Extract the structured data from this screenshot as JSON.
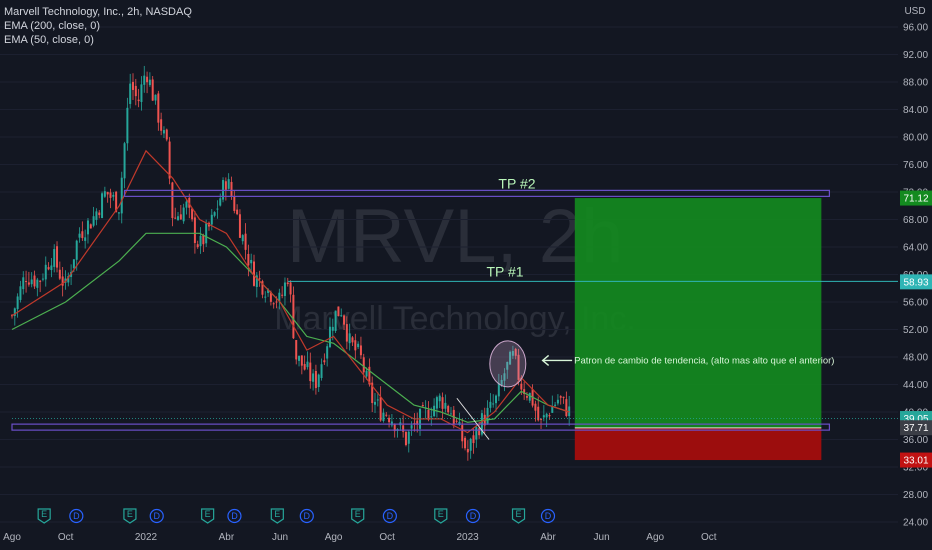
{
  "header": {
    "symbol_line": "Marvell Technology, Inc., 2h, NASDAQ",
    "indicator_1": "EMA (200, close, 0)",
    "indicator_2": "EMA (50, close, 0)"
  },
  "watermark": {
    "ticker": "MRVL, 2h",
    "company": "Marvell Technology, Inc."
  },
  "colors": {
    "background": "#131722",
    "candle_up": "#26a69a",
    "candle_down": "#ef5350",
    "ema200": "#4caf50",
    "ema50": "#c0392b",
    "profit_zone": "#138a1f",
    "loss_zone": "#a30d0d",
    "level_line": "#6b4fc8",
    "tp1_line": "#2fb5b5"
  },
  "chart_data": {
    "type": "candlestick",
    "currency": "USD",
    "y_range": [
      24,
      96
    ],
    "y_ticks": [
      "96.00",
      "92.00",
      "88.00",
      "84.00",
      "80.00",
      "76.00",
      "72.00",
      "68.00",
      "64.00",
      "60.00",
      "56.00",
      "52.00",
      "48.00",
      "44.00",
      "40.00",
      "36.00",
      "32.00",
      "28.00",
      "24.00"
    ],
    "x_ticks": [
      {
        "label": "Ago",
        "t": 0
      },
      {
        "label": "Oct",
        "t": 2
      },
      {
        "label": "2022",
        "t": 5
      },
      {
        "label": "Abr",
        "t": 8
      },
      {
        "label": "Jun",
        "t": 10
      },
      {
        "label": "Ago",
        "t": 12
      },
      {
        "label": "Oct",
        "t": 14
      },
      {
        "label": "2023",
        "t": 17
      },
      {
        "label": "Abr",
        "t": 20
      },
      {
        "label": "Jun",
        "t": 22
      },
      {
        "label": "Ago",
        "t": 24
      },
      {
        "label": "Oct",
        "t": 26
      }
    ],
    "price_path": [
      [
        0,
        54
      ],
      [
        0.5,
        60
      ],
      [
        1,
        59
      ],
      [
        1.5,
        63
      ],
      [
        2,
        58
      ],
      [
        2.5,
        66
      ],
      [
        3,
        68
      ],
      [
        3.5,
        72
      ],
      [
        4,
        70
      ],
      [
        4.4,
        88
      ],
      [
        4.7,
        85
      ],
      [
        5,
        90
      ],
      [
        5.4,
        84
      ],
      [
        5.8,
        78
      ],
      [
        6,
        68
      ],
      [
        6.5,
        70
      ],
      [
        6.8,
        66
      ],
      [
        7,
        64
      ],
      [
        7.5,
        68
      ],
      [
        8,
        74
      ],
      [
        8.3,
        70
      ],
      [
        8.7,
        64
      ],
      [
        9,
        60
      ],
      [
        9.5,
        58
      ],
      [
        10,
        56
      ],
      [
        10.3,
        60
      ],
      [
        10.6,
        48
      ],
      [
        11,
        46
      ],
      [
        11.3,
        44
      ],
      [
        11.6,
        48
      ],
      [
        12,
        54
      ],
      [
        12.3,
        55
      ],
      [
        12.6,
        50
      ],
      [
        13,
        48
      ],
      [
        13.4,
        42
      ],
      [
        13.8,
        40
      ],
      [
        14,
        40
      ],
      [
        14.4,
        38
      ],
      [
        14.7,
        36
      ],
      [
        15,
        38
      ],
      [
        15.5,
        40
      ],
      [
        16,
        42
      ],
      [
        16.4,
        40
      ],
      [
        16.8,
        36
      ],
      [
        17,
        34
      ],
      [
        17.4,
        38
      ],
      [
        17.8,
        40
      ],
      [
        18.1,
        42
      ],
      [
        18.4,
        46
      ],
      [
        18.7,
        48
      ],
      [
        19,
        44
      ],
      [
        19.4,
        42
      ],
      [
        19.7,
        38
      ],
      [
        20,
        40
      ],
      [
        20.4,
        42
      ],
      [
        20.8,
        40
      ]
    ],
    "ema200": [
      [
        0,
        52
      ],
      [
        2,
        56
      ],
      [
        4,
        62
      ],
      [
        5,
        66
      ],
      [
        6,
        66
      ],
      [
        7,
        66
      ],
      [
        8,
        64
      ],
      [
        9,
        60
      ],
      [
        10,
        56
      ],
      [
        11,
        51
      ],
      [
        12,
        50
      ],
      [
        13,
        47
      ],
      [
        14,
        44
      ],
      [
        15,
        41
      ],
      [
        16,
        40
      ],
      [
        17,
        38.5
      ],
      [
        18,
        39
      ],
      [
        19,
        43
      ],
      [
        20,
        41
      ],
      [
        20.8,
        40
      ]
    ],
    "ema50": [
      [
        0,
        54
      ],
      [
        2,
        59
      ],
      [
        4,
        70
      ],
      [
        5,
        78
      ],
      [
        6,
        74
      ],
      [
        7,
        68
      ],
      [
        8,
        66
      ],
      [
        9,
        60
      ],
      [
        10,
        56
      ],
      [
        11,
        49
      ],
      [
        12,
        51
      ],
      [
        13,
        46
      ],
      [
        14,
        41
      ],
      [
        15,
        39
      ],
      [
        16,
        39
      ],
      [
        17,
        37
      ],
      [
        18,
        40
      ],
      [
        19,
        45
      ],
      [
        20,
        41
      ],
      [
        20.8,
        40
      ]
    ],
    "levels": [
      {
        "name": "TP #2",
        "label": "TP #2",
        "price": 71.8,
        "t_start": 4.2,
        "t_end": 30.5
      },
      {
        "name": "TP #1",
        "label": "TP #1",
        "price": 59.0,
        "t_start": 10.3,
        "t_end": 35
      },
      {
        "name": "support",
        "price": 37.8,
        "t_start": 0,
        "t_end": 30.5
      },
      {
        "name": "last",
        "price": 39.05,
        "t_start": 0,
        "t_end": 35
      }
    ],
    "position": {
      "t_start": 21.0,
      "t_end": 30.2,
      "entry": 37.7,
      "target": 71.12,
      "stop": 33.01
    },
    "annotation": {
      "text": "Patron de cambio de tendencia, (alto mas alto que el anterior)",
      "t": 18.5,
      "price": 47.0
    },
    "price_labels": [
      {
        "value": "71.12",
        "price": 71.12,
        "color": "#138a1f"
      },
      {
        "value": "58.93",
        "price": 58.93,
        "color": "#2fb5b5"
      },
      {
        "value": "39.05",
        "price": 39.05,
        "color": "#26a69a"
      },
      {
        "value": "37.71",
        "price": 37.71,
        "color": "#3b3e46"
      },
      {
        "value": "33.01",
        "price": 33.01,
        "color": "#c21212"
      }
    ],
    "events": [
      {
        "type": "E",
        "t": 1.2
      },
      {
        "type": "D",
        "t": 2.4
      },
      {
        "type": "E",
        "t": 4.4
      },
      {
        "type": "D",
        "t": 5.4
      },
      {
        "type": "E",
        "t": 7.3
      },
      {
        "type": "D",
        "t": 8.3
      },
      {
        "type": "E",
        "t": 9.9
      },
      {
        "type": "D",
        "t": 11.0
      },
      {
        "type": "E",
        "t": 12.9
      },
      {
        "type": "D",
        "t": 14.1
      },
      {
        "type": "E",
        "t": 16.0
      },
      {
        "type": "D",
        "t": 17.2
      },
      {
        "type": "E",
        "t": 18.9
      },
      {
        "type": "D",
        "t": 20.0
      }
    ]
  }
}
